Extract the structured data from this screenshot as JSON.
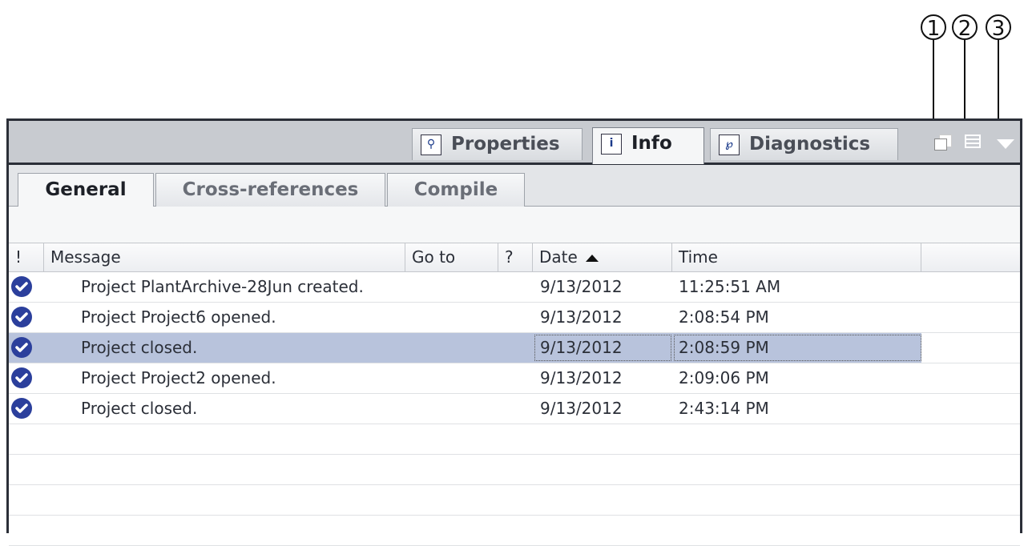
{
  "callouts": [
    "1",
    "2",
    "3"
  ],
  "top_tabs": [
    {
      "label": "Properties",
      "icon": "properties-icon"
    },
    {
      "label": "Info",
      "icon": "info-icon",
      "active": true
    },
    {
      "label": "Diagnostics",
      "icon": "diagnostics-icon"
    }
  ],
  "sub_tabs": [
    {
      "label": "General",
      "active": true
    },
    {
      "label": "Cross-references"
    },
    {
      "label": "Compile"
    }
  ],
  "table": {
    "columns": [
      "!",
      "Message",
      "Go to",
      "?",
      "Date",
      "Time"
    ],
    "sort_column": "Date",
    "rows": [
      {
        "status": "check-icon",
        "message": "Project PlantArchive-28Jun created.",
        "date": "9/13/2012",
        "time": "11:25:51 AM"
      },
      {
        "status": "check-icon",
        "message": "Project Project6 opened.",
        "date": "9/13/2012",
        "time": "2:08:54 PM"
      },
      {
        "status": "check-icon",
        "message": "Project closed.",
        "date": "9/13/2012",
        "time": "2:08:59 PM",
        "selected": true
      },
      {
        "status": "check-icon",
        "message": "Project Project2 opened.",
        "date": "9/13/2012",
        "time": "2:09:06 PM"
      },
      {
        "status": "check-icon",
        "message": "Project closed.",
        "date": "9/13/2012",
        "time": "2:43:14 PM"
      }
    ]
  },
  "colors": {
    "selection": "#b8c3dc",
    "status_icon": "#2b3f9c",
    "frame": "#2b2f38"
  }
}
